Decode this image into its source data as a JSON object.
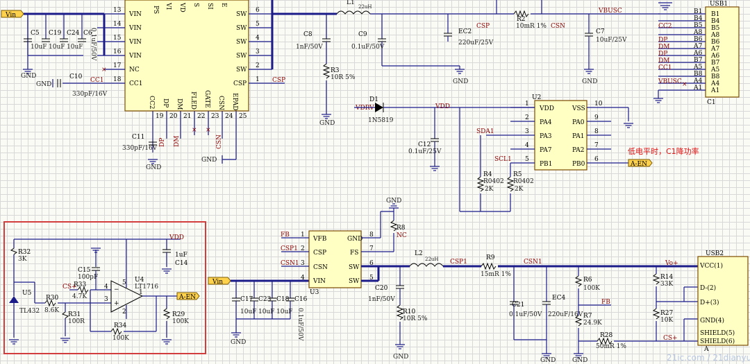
{
  "schematic": {
    "chips": {
      "u_main": {
        "pins_left": [
          "VIN",
          "VIN",
          "VIN",
          "VIN",
          "NC",
          "CC1"
        ],
        "pin_nums_left": [
          "13",
          "14",
          "15",
          "16",
          "17",
          "18"
        ],
        "pins_right": [
          "SW",
          "SW",
          "SW",
          "SW",
          "SW",
          "CSP"
        ],
        "pin_nums_right": [
          "6",
          "5",
          "4",
          "3",
          "2",
          "1"
        ],
        "pins_bottom": [
          "CC2",
          "DP",
          "DM",
          "FLED",
          "GATE",
          "CSN",
          "EPAD"
        ],
        "pin_nums_bottom": [
          "19",
          "20",
          "21",
          "22",
          "23",
          "24",
          "25"
        ],
        "pins_top": [
          "PS",
          "VI",
          "VD",
          "S",
          "SI",
          "E"
        ]
      },
      "u2": {
        "designator": "U2",
        "pins_left": [
          "VDD",
          "PA4",
          "PA3",
          "PA7",
          "PB1"
        ],
        "pin_nums_left": [
          "1",
          "2",
          "3",
          "4",
          "5"
        ],
        "pins_right": [
          "VSS",
          "PA0",
          "PA1",
          "PA2",
          "PB0"
        ],
        "pin_nums_right": [
          "10",
          "9",
          "8",
          "7",
          "6"
        ]
      },
      "u3": {
        "designator": "U3",
        "pins_left": [
          "VFB",
          "CSP",
          "CSN",
          "VIN"
        ],
        "pin_nums_left": [
          "1",
          "2",
          "3",
          "4"
        ],
        "pins_right": [
          "GND",
          "FS",
          "SW",
          "SW"
        ],
        "pin_nums_right": [
          "8",
          "7",
          "6",
          "5"
        ]
      },
      "usb1": {
        "designator": "USB1",
        "pins_outer": [
          "B1",
          "B4",
          "B5",
          "A8",
          "B6",
          "A7",
          "A6",
          "B7",
          "A5",
          "B8",
          "A4",
          "A1"
        ],
        "pins_inner": [
          "B1",
          "B4",
          "B5",
          "A8",
          "B6",
          "A7",
          "A6",
          "B7",
          "A5",
          "B8",
          "A4",
          "A1"
        ],
        "sub": "C1"
      },
      "usb2": {
        "designator": "USB2",
        "pins": [
          "VCC(1)",
          "D-(2)",
          "D+(3)",
          "GND(4)",
          "SHIELD(5)",
          "SHIELD(6)"
        ],
        "sub": "A"
      },
      "u4": {
        "designator": "U4",
        "part": "LT1716",
        "pin_plus": "3",
        "pin_minus": "4",
        "pin_out": "1",
        "pin_v": "5",
        "pin_g": "2"
      },
      "u5": {
        "designator": "U5",
        "part": "TL432"
      }
    },
    "parts": {
      "c5": {
        "d": "C5",
        "v": "10uF"
      },
      "c19": {
        "d": "C19",
        "v": "10uF"
      },
      "c24": {
        "d": "C24",
        "v": "10uF"
      },
      "c6": {
        "d": "C6",
        "v": "0.1uF/50V"
      },
      "c10": {
        "d": "C10",
        "v": "330pF/16V"
      },
      "c11": {
        "d": "C11",
        "v": "330pF/16V"
      },
      "c8": {
        "d": "C8",
        "v": "1nF/50V"
      },
      "r3": {
        "d": "R3",
        "v": "10R 5%"
      },
      "l1": {
        "d": "L1",
        "v": "22uH"
      },
      "c9": {
        "d": "C9",
        "v": "0.1uF/50V"
      },
      "ec2": {
        "d": "EC2",
        "v": "220uF/25V"
      },
      "r2": {
        "d": "R2",
        "v": "10mR 1%"
      },
      "c7": {
        "d": "C7",
        "v": "10uF/25V"
      },
      "d1": {
        "d": "D1",
        "v": "1N5819"
      },
      "c12": {
        "d": "C12",
        "v": "0.1uF/25V"
      },
      "r4": {
        "d": "R4",
        "v": "R0402",
        "v2": "2K"
      },
      "r5": {
        "d": "R5",
        "v": "R0402",
        "v2": "2K"
      },
      "r8": {
        "d": "R8",
        "v": "NC"
      },
      "l2": {
        "d": "L2",
        "v": "22uH"
      },
      "r9": {
        "d": "R9",
        "v": "15mR 1%"
      },
      "c17": {
        "d": "C17",
        "v": "10uF"
      },
      "c23": {
        "d": "C23",
        "v": "10uF"
      },
      "c18": {
        "d": "C18",
        "v": "10uF"
      },
      "c16": {
        "d": "C16",
        "v": "0.1uF/50V"
      },
      "c20": {
        "d": "C20",
        "v": "1nF/50V"
      },
      "r10": {
        "d": "R10",
        "v": "10R 5%"
      },
      "c21": {
        "d": "C21",
        "v": "0.1uF/50V"
      },
      "ec4": {
        "d": "EC4",
        "v": "220uF/16V"
      },
      "r6": {
        "d": "R6",
        "v": "100K"
      },
      "r7": {
        "d": "R7",
        "v": "24.9K"
      },
      "r28": {
        "d": "R28",
        "v": "50mR 1%"
      },
      "r14": {
        "d": "R14",
        "v": "33K"
      },
      "r27": {
        "d": "R27",
        "v": "10K"
      },
      "r32": {
        "d": "R32",
        "v": "3K"
      },
      "c14": {
        "d": "C14",
        "v": "1uF"
      },
      "c15": {
        "d": "C15",
        "v": "100pF"
      },
      "r33": {
        "d": "R33",
        "v": "4.7K"
      },
      "r30": {
        "d": "R30",
        "v": "8.6K"
      },
      "r31": {
        "d": "R31",
        "v": "100R"
      },
      "r34": {
        "d": "R34",
        "v": "100K"
      },
      "r29": {
        "d": "R29",
        "v": "100K"
      }
    },
    "nets": {
      "cc1": "CC1",
      "csp": "CSP",
      "csn": "CSN",
      "vbusc": "VBUSC",
      "cc2": "CC2",
      "dp": "DP",
      "dm": "DM",
      "cc1b": "CC1",
      "vbusc2": "VBUSC",
      "vdrv": "VDRV",
      "vdd": "VDD",
      "sda1": "SDA1",
      "scl1": "SCL1",
      "fb": "FB",
      "csp1": "CSP1",
      "csn1": "CSN1",
      "csp1b": "CSP1",
      "csn1b": "CSN1",
      "fb2": "FB",
      "cs_plus": "CS+",
      "cs_plus2": "CS+",
      "vo_plus": "Vo+",
      "vdd2": "VDD",
      "cspb": "CSP",
      "csnb": "CSN",
      "dp2": "DP",
      "dm2": "DM",
      "csn_b": "CSN",
      "dp3": "DP",
      "dm3": "DM"
    },
    "tags": {
      "vin1": "Vin",
      "vin2": "Vin",
      "aen1": "A-EN",
      "aen2": "A-EN"
    },
    "gnd": "GND",
    "note": "低电平时，C1降功率",
    "watermark": "21ic.com / 21dianyuan.com"
  }
}
